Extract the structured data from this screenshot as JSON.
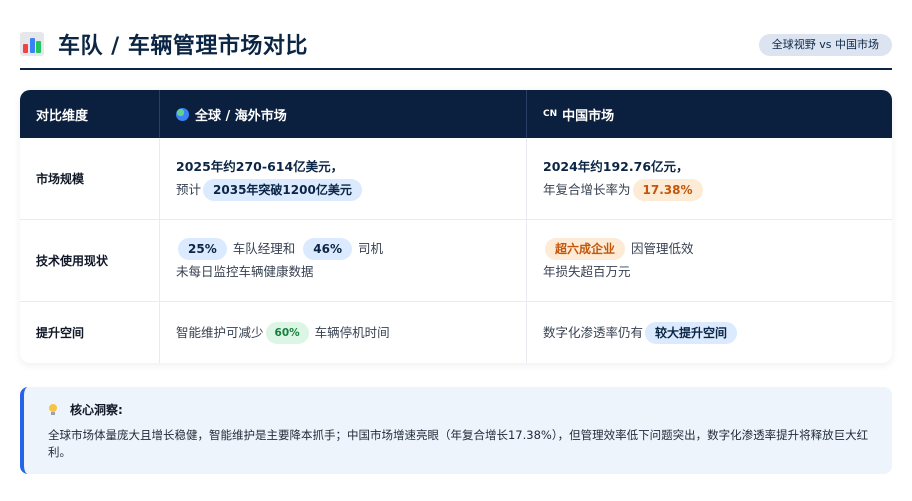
{
  "header": {
    "title": "车队 / 车辆管理市场对比",
    "tag": "全球视野 vs 中国市场",
    "icon": "bar-chart-icon"
  },
  "table": {
    "columns": [
      "对比维度",
      "全球 / 海外市场",
      "中国市场"
    ],
    "cn_badge": "CN",
    "rows": [
      {
        "dimension": "市场规模",
        "global": {
          "line1": "2025年约270-614亿美元，",
          "line2_prefix": "预计",
          "line2_pill": "2035年突破1200亿美元"
        },
        "china": {
          "line1": "2024年约192.76亿元，",
          "line2_prefix": "年复合增长率为",
          "line2_pill": "17.38%"
        }
      },
      {
        "dimension": "技术使用现状",
        "global": {
          "pill_a": "25%",
          "text_a": "车队经理和",
          "pill_b": "46%",
          "text_b": "司机",
          "line2": "未每日监控车辆健康数据"
        },
        "china": {
          "pill": "超六成企业",
          "text": "因管理低效",
          "line2": "年损失超百万元"
        }
      },
      {
        "dimension": "提升空间",
        "global": {
          "prefix": "智能维护可减少",
          "pill": "60%",
          "suffix": "车辆停机时间"
        },
        "china": {
          "prefix": "数字化渗透率仍有",
          "pill": "较大提升空间"
        }
      }
    ]
  },
  "insight": {
    "title": "核心洞察:",
    "body": "全球市场体量庞大且增长稳健，智能维护是主要降本抓手；中国市场增速亮眼（年复合增长17.38%），但管理效率低下问题突出，数字化渗透率提升将释放巨大红利。"
  },
  "colors": {
    "navy": "#0b1f3f",
    "accent_blue": "#2563eb",
    "pill_blue_bg": "#dbeafe",
    "pill_orange_bg": "#fdebd5",
    "pill_orange_text": "#c2560c",
    "pill_green_bg": "#dcf5e4",
    "pill_green_text": "#15803d"
  }
}
